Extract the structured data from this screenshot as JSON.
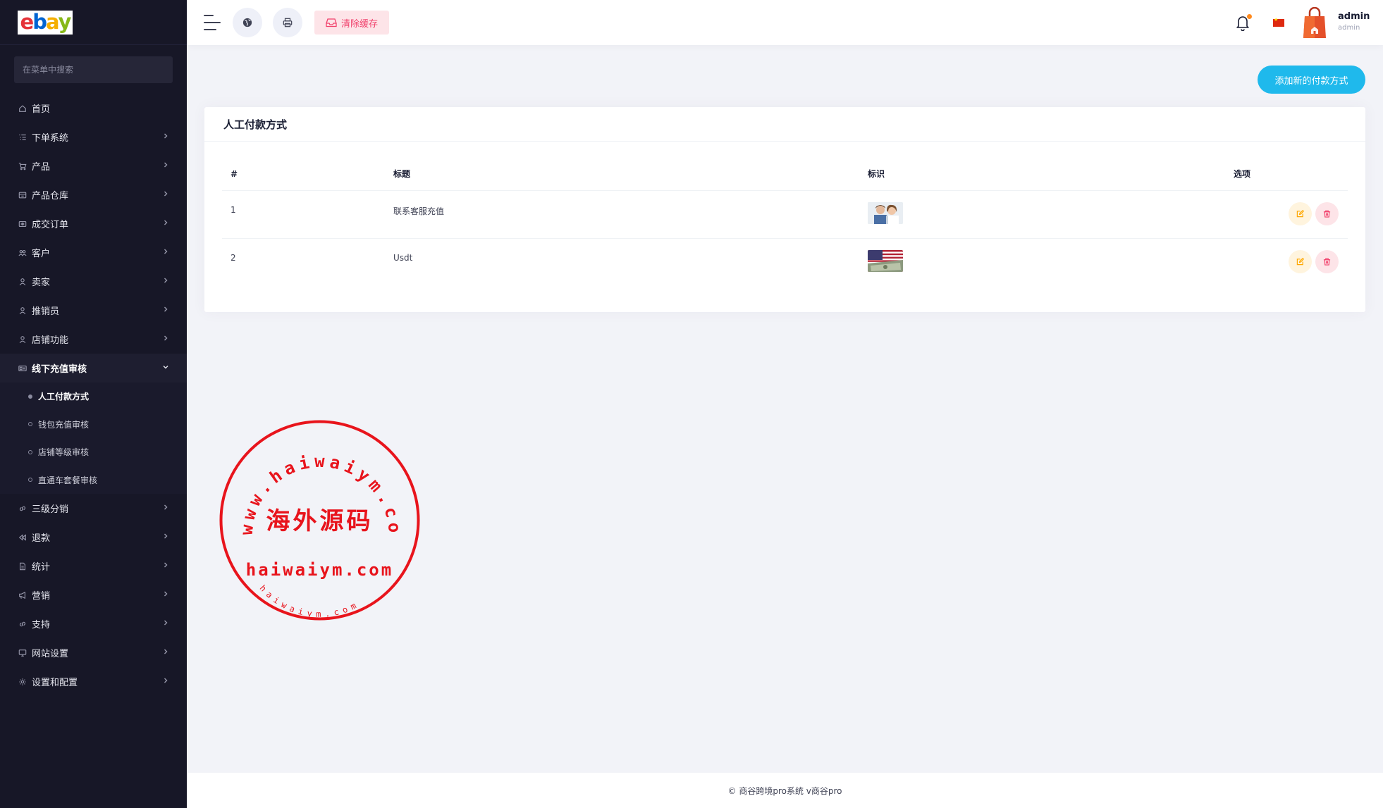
{
  "brand": {
    "logo_letters": [
      "e",
      "b",
      "a",
      "y"
    ]
  },
  "sidebar": {
    "search_placeholder": "在菜单中搜索",
    "items": [
      {
        "label": "首页",
        "icon": "home-icon",
        "has_children": false
      },
      {
        "label": "下单系统",
        "icon": "list-icon",
        "has_children": true
      },
      {
        "label": "产品",
        "icon": "cart-icon",
        "has_children": true
      },
      {
        "label": "产品仓库",
        "icon": "warehouse-icon",
        "has_children": true
      },
      {
        "label": "成交订单",
        "icon": "order-icon",
        "has_children": true
      },
      {
        "label": "客户",
        "icon": "users-icon",
        "has_children": true
      },
      {
        "label": "卖家",
        "icon": "user-icon",
        "has_children": true
      },
      {
        "label": "推销员",
        "icon": "user-icon",
        "has_children": true
      },
      {
        "label": "店铺功能",
        "icon": "user-icon",
        "has_children": true
      },
      {
        "label": "线下充值审核",
        "icon": "money-icon",
        "has_children": true,
        "open": true,
        "children": [
          "人工付款方式",
          "钱包充值审核",
          "店铺等级审核",
          "直通车套餐审核"
        ],
        "active_child": 0
      },
      {
        "label": "三级分销",
        "icon": "link-icon",
        "has_children": true
      },
      {
        "label": "退款",
        "icon": "refund-icon",
        "has_children": true
      },
      {
        "label": "统计",
        "icon": "file-icon",
        "has_children": true
      },
      {
        "label": "营销",
        "icon": "megaphone-icon",
        "has_children": true
      },
      {
        "label": "支持",
        "icon": "link-icon",
        "has_children": true
      },
      {
        "label": "网站设置",
        "icon": "monitor-icon",
        "has_children": true
      },
      {
        "label": "设置和配置",
        "icon": "gear-icon",
        "has_children": true
      }
    ]
  },
  "header": {
    "clear_cache_label": "清除缓存",
    "user_name": "admin",
    "user_role": "admin",
    "notification_dot_color": "#ff8a1e"
  },
  "main": {
    "add_button_label": "添加新的付款方式",
    "card_title": "人工付款方式",
    "table": {
      "columns": [
        "#",
        "标题",
        "标识",
        "选项"
      ],
      "rows": [
        {
          "index": "1",
          "title": "联系客服充值",
          "logo": "customer-service-photo"
        },
        {
          "index": "2",
          "title": "Usdt",
          "logo": "us-flag-dollar-photo"
        }
      ]
    }
  },
  "watermark": {
    "ring_text": "www.haiwaiym.com",
    "center_text": "海外源码",
    "domain_text": "haiwaiym.com",
    "bottom_text": "haiwaiym.com",
    "color": "#e8141c"
  },
  "footer": {
    "text": "© 商谷跨境pro系统 v商谷pro"
  },
  "colors": {
    "sidebar_bg": "#171727",
    "accent_button": "#1fb9ec",
    "danger": "#f1416c",
    "warning": "#ffa800"
  }
}
